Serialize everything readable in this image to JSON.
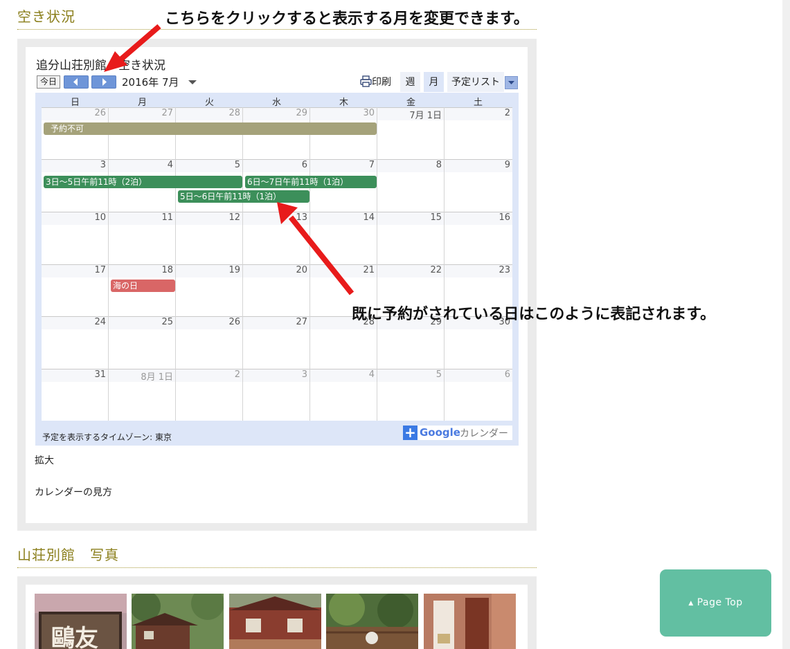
{
  "sections": {
    "availability_title": "空き状況",
    "photos_title": "山荘別館　写真"
  },
  "annotations": {
    "top": "こちらをクリックすると表示する月を変更できます。",
    "middle": "既に予約がされている日はこのように表記されます。"
  },
  "calendar": {
    "title": "追分山荘別館　空き状況",
    "today_label": "今日",
    "month_label": "2016年 7月",
    "print_label": "印刷",
    "view_tabs": [
      "週",
      "月",
      "予定リスト"
    ],
    "weekdays": [
      "日",
      "月",
      "火",
      "水",
      "木",
      "金",
      "土"
    ],
    "weeks": [
      [
        "26",
        "27",
        "28",
        "29",
        "30",
        "7月 1日",
        "2"
      ],
      [
        "3",
        "4",
        "5",
        "6",
        "7",
        "8",
        "9"
      ],
      [
        "10",
        "11",
        "12",
        "13",
        "14",
        "15",
        "16"
      ],
      [
        "17",
        "18",
        "19",
        "20",
        "21",
        "22",
        "23"
      ],
      [
        "24",
        "25",
        "26",
        "27",
        "28",
        "29",
        "30"
      ],
      [
        "31",
        "8月 1日",
        "2",
        "3",
        "4",
        "5",
        "6"
      ]
    ],
    "events": [
      {
        "label": "予約不可",
        "color": "#a5a27a"
      },
      {
        "label": "3日〜5日午前11時（2泊）",
        "color": "#3c8f5a"
      },
      {
        "label": "6日〜7日午前11時（1泊）",
        "color": "#3c8f5a"
      },
      {
        "label": "5日〜6日午前11時（1泊）",
        "color": "#3c8f5a"
      },
      {
        "label": "海の日",
        "color": "#d96666"
      }
    ],
    "timezone_text": "予定を表示するタイムゾーン: 東京",
    "google_word": "Google",
    "google_suffix": "カレンダー"
  },
  "links": {
    "enlarge": "拡大",
    "how_to_read": "カレンダーの見方"
  },
  "page_top_label": "Page Top",
  "colors": {
    "accent_title": "#8b7f1c",
    "nav_button": "#6e95d8",
    "booked": "#3c8f5a",
    "unavailable": "#a5a27a",
    "holiday": "#d96666",
    "page_top": "#62bfa2",
    "arrow": "#e81b1b"
  }
}
